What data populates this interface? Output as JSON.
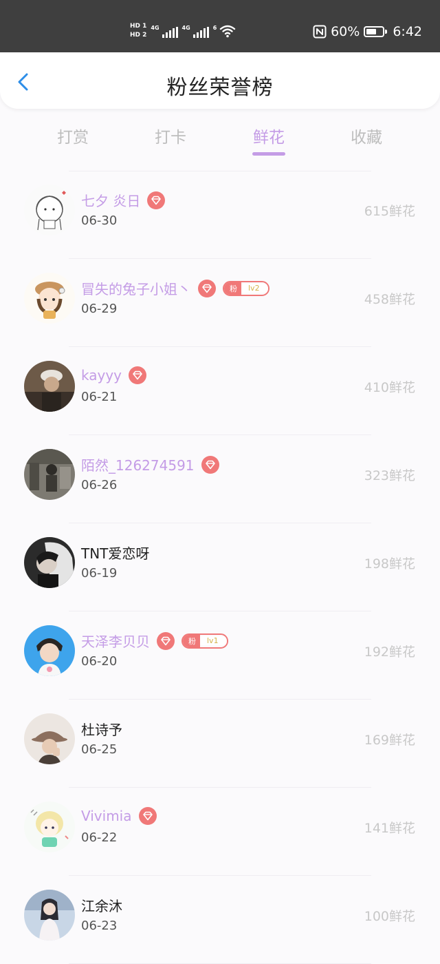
{
  "status_bar": {
    "hd1": "HD 1",
    "hd2": "HD 2",
    "net1": "4G",
    "net2": "4G",
    "wifi_label": "6",
    "battery": "60%",
    "battery_level": 0.6,
    "time": "6:42"
  },
  "header": {
    "title": "粉丝荣誉榜"
  },
  "tabs": [
    {
      "label": "打赏"
    },
    {
      "label": "打卡"
    },
    {
      "label": "鲜花"
    },
    {
      "label": "收藏"
    }
  ],
  "active_tab": "鲜花",
  "colors": {
    "accent": "#c49ce6",
    "badge": "#f07878",
    "count": "#c8c8c8"
  },
  "ranking": [
    {
      "name": "七夕 炎日",
      "date": "06-30",
      "count": "615鲜花",
      "vip": true,
      "fan_level": null,
      "avatar": "cartoon-girl-avatar"
    },
    {
      "name": "冒失的兔子小姐丶",
      "date": "06-29",
      "count": "458鲜花",
      "vip": true,
      "fan_level": "lv2",
      "fan_label": "粉",
      "avatar": "cartoon-hat-girl-avatar"
    },
    {
      "name": "kayyy",
      "date": "06-21",
      "count": "410鲜花",
      "vip": true,
      "fan_level": null,
      "avatar": "photo-cap-avatar"
    },
    {
      "name": "陌然_126274591",
      "date": "06-26",
      "count": "323鲜花",
      "vip": true,
      "fan_level": null,
      "avatar": "photo-street-avatar"
    },
    {
      "name": "TNT爱恋呀",
      "date": "06-19",
      "count": "198鲜花",
      "vip": false,
      "fan_level": null,
      "avatar": "photo-bw-avatar"
    },
    {
      "name": "天泽李贝贝",
      "date": "06-20",
      "count": "192鲜花",
      "vip": true,
      "fan_level": "lv1",
      "fan_label": "粉",
      "avatar": "photo-blue-avatar"
    },
    {
      "name": "杜诗予",
      "date": "06-25",
      "count": "169鲜花",
      "vip": false,
      "fan_level": null,
      "avatar": "photo-hat-avatar"
    },
    {
      "name": "Vivimia",
      "date": "06-22",
      "count": "141鲜花",
      "vip": true,
      "fan_level": null,
      "avatar": "cartoon-green-avatar"
    },
    {
      "name": "江余沐",
      "date": "06-23",
      "count": "100鲜花",
      "vip": false,
      "fan_level": null,
      "avatar": "photo-girl-avatar"
    }
  ]
}
